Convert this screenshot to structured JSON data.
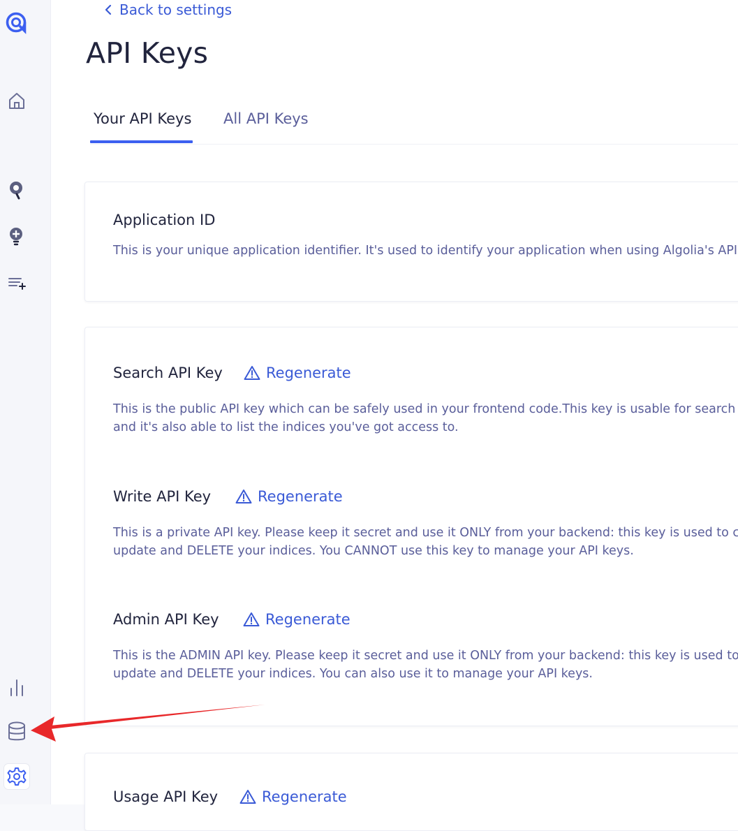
{
  "nav": {
    "back_label": "Back to settings"
  },
  "page": {
    "title": "API Keys"
  },
  "tabs": [
    {
      "label": "Your API Keys",
      "active": true
    },
    {
      "label": "All API Keys",
      "active": false
    }
  ],
  "sidebar": {
    "icons": [
      "algolia-logo-icon",
      "home-icon",
      "search-icon",
      "discovery-icon",
      "list-add-icon",
      "analytics-icon",
      "data-sources-icon",
      "settings-icon"
    ],
    "active": "settings-icon"
  },
  "application_id": {
    "title": "Application ID",
    "description": "This is your unique application identifier. It's used to identify your application when using Algolia's API."
  },
  "keys": [
    {
      "title": "Search API Key",
      "regenerate_label": "Regenerate",
      "description_line1": "This is the public API key which can be safely used in your frontend code.This key is usable for search qu",
      "description_line2": "and it's also able to list the indices you've got access to."
    },
    {
      "title": "Write API Key",
      "regenerate_label": "Regenerate",
      "description_line1": "This is a private API key. Please keep it secret and use it ONLY from your backend: this key is used to cre",
      "description_line2": "update and DELETE your indices. You CANNOT use this key to manage your API keys."
    },
    {
      "title": "Admin API Key",
      "regenerate_label": "Regenerate",
      "description_line1": "This is the ADMIN API key. Please keep it secret and use it ONLY from your backend: this key is used to c",
      "description_line2": "update and DELETE your indices. You can also use it to manage your API keys."
    },
    {
      "title": "Usage API Key",
      "regenerate_label": "Regenerate"
    }
  ],
  "colors": {
    "accent": "#3a5ad6",
    "tab_underline": "#3c5ff0",
    "annotation_arrow": "#e8282a",
    "text_primary": "#21243d",
    "text_secondary": "#5a5e9a"
  }
}
